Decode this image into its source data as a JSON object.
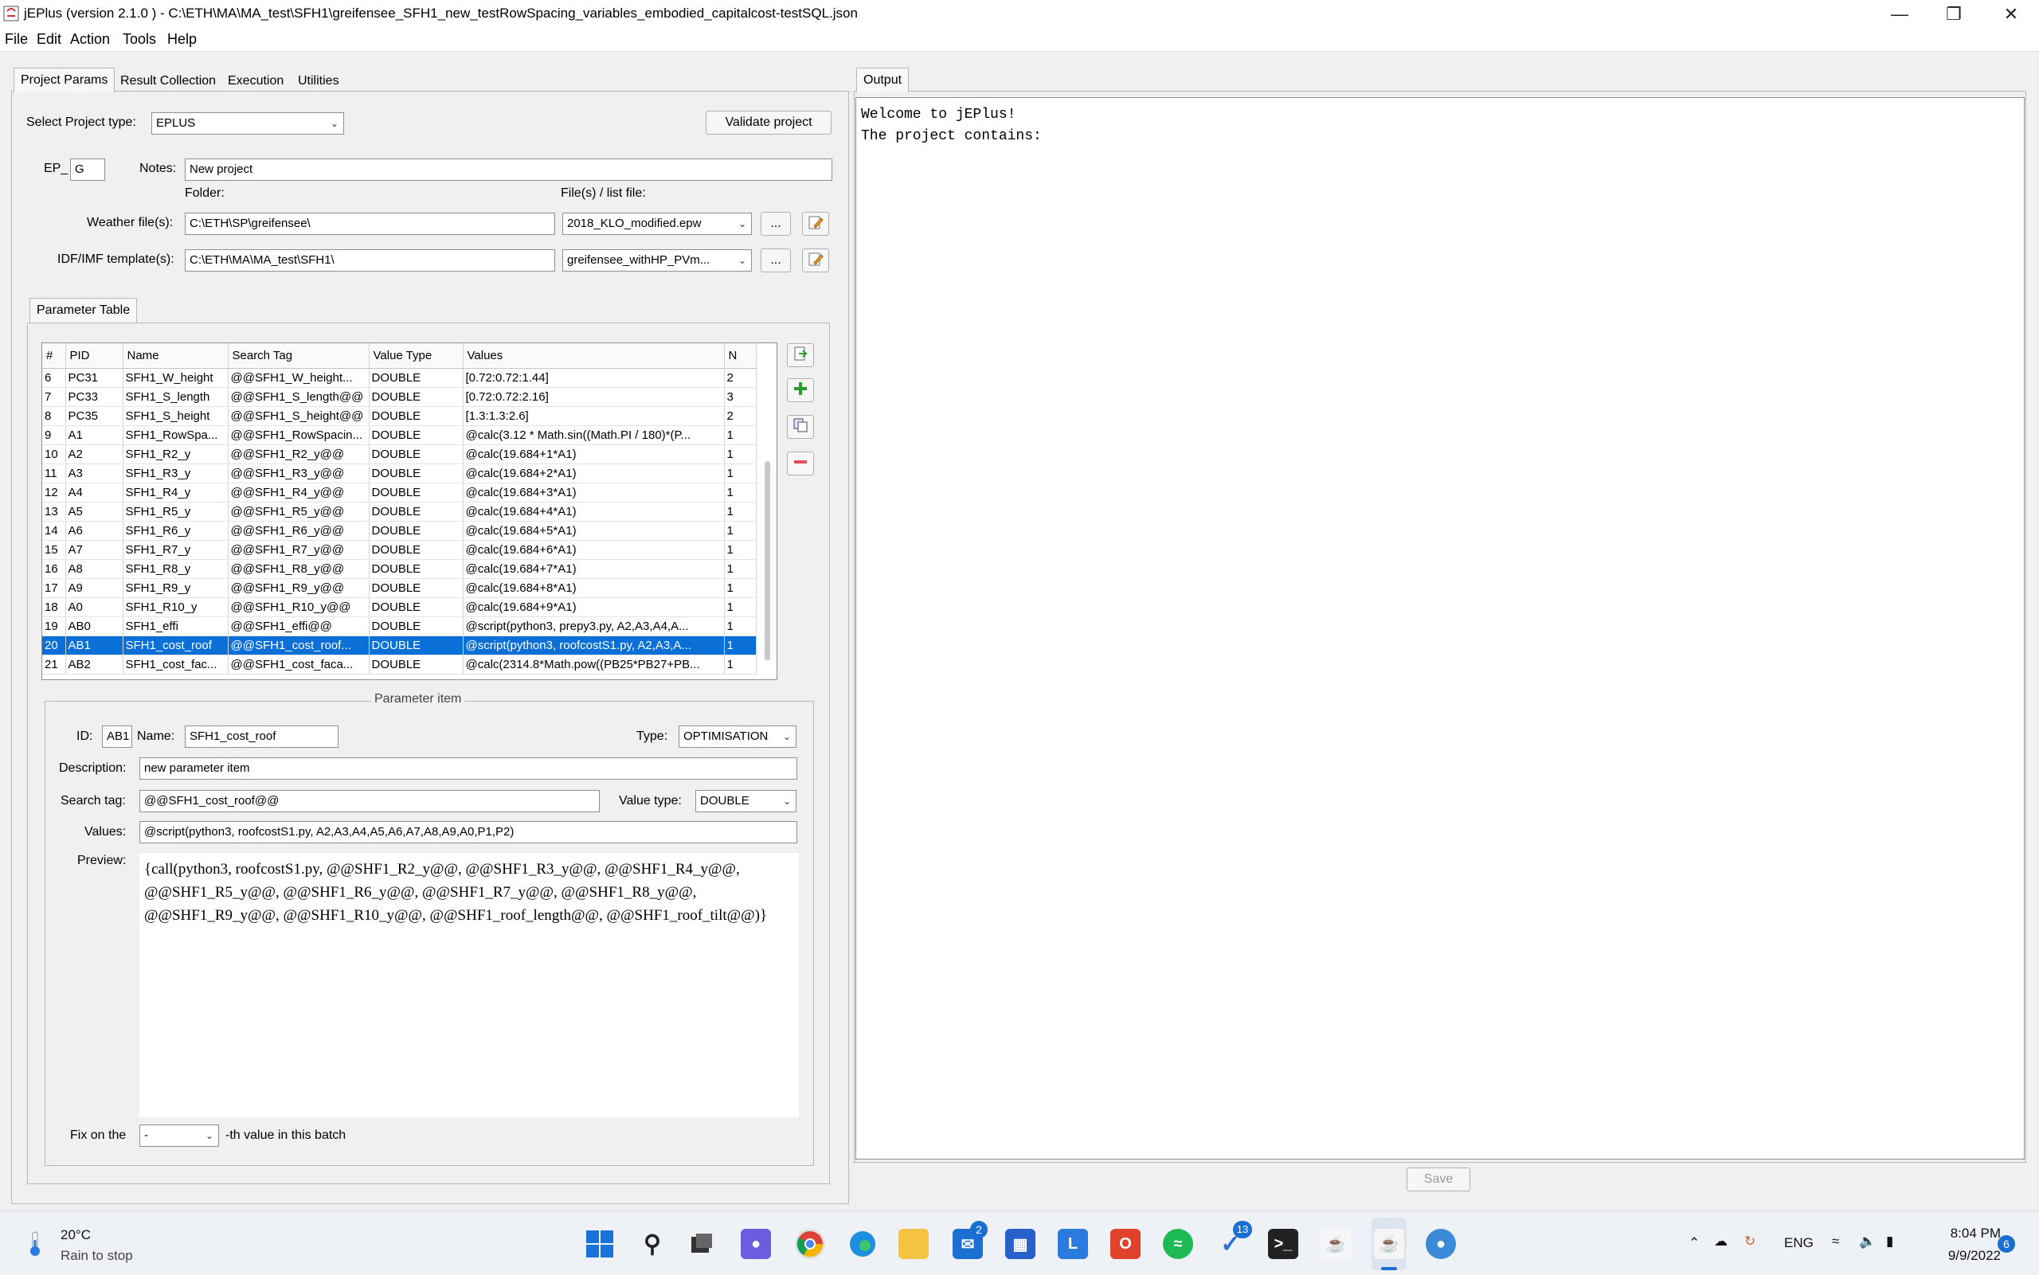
{
  "window": {
    "title": "jEPlus (version 2.1.0 )  - C:\\ETH\\MA\\MA_test\\SFH1\\greifensee_SFH1_new_testRowSpacing_variables_embodied_capitalcost-testSQL.json",
    "minimize_icon": "minimize-icon",
    "maximize_icon": "restore-icon",
    "close_icon": "close-icon"
  },
  "menu": [
    "File",
    "Edit",
    "Action",
    "Tools",
    "Help"
  ],
  "left_tabs": [
    "Project Params",
    "Result Collection",
    "Execution",
    "Utilities"
  ],
  "output_tab": "Output",
  "project": {
    "type_label": "Select Project type:",
    "type_value": "EPLUS",
    "validate_label": "Validate project",
    "ep_prefix": "EP_",
    "ep_value": "G",
    "notes_label": "Notes:",
    "notes_value": "New project",
    "folder_label": "Folder:",
    "files_label": "File(s) / list file:",
    "weather_label": "Weather file(s):",
    "weather_folder": "C:\\ETH\\SP\\greifensee\\",
    "weather_file": "2018_KLO_modified.epw",
    "idf_label": "IDF/IMF template(s):",
    "idf_folder": "C:\\ETH\\MA\\MA_test\\SFH1\\",
    "idf_file": "greifensee_withHP_PVm...",
    "browse_label": "..."
  },
  "param_table": {
    "tab_label": "Parameter Table",
    "columns": [
      "#",
      "PID",
      "Name",
      "Search Tag",
      "Value Type",
      "Values",
      "N"
    ],
    "rows": [
      [
        "6",
        "PC31",
        "SFH1_W_height",
        "@@SFH1_W_height...",
        "DOUBLE",
        "[0.72:0.72:1.44]",
        "2"
      ],
      [
        "7",
        "PC33",
        "SFH1_S_length",
        "@@SFH1_S_length@@",
        "DOUBLE",
        "[0.72:0.72:2.16]",
        "3"
      ],
      [
        "8",
        "PC35",
        "SFH1_S_height",
        "@@SFH1_S_height@@",
        "DOUBLE",
        "[1.3:1.3:2.6]",
        "2"
      ],
      [
        "9",
        "A1",
        "SFH1_RowSpa...",
        "@@SFH1_RowSpacin...",
        "DOUBLE",
        "@calc(3.12 * Math.sin((Math.PI / 180)*(P...",
        "1"
      ],
      [
        "10",
        "A2",
        "SFH1_R2_y",
        "@@SFH1_R2_y@@",
        "DOUBLE",
        "@calc(19.684+1*A1)",
        "1"
      ],
      [
        "11",
        "A3",
        "SFH1_R3_y",
        "@@SFH1_R3_y@@",
        "DOUBLE",
        "@calc(19.684+2*A1)",
        "1"
      ],
      [
        "12",
        "A4",
        "SFH1_R4_y",
        "@@SFH1_R4_y@@",
        "DOUBLE",
        "@calc(19.684+3*A1)",
        "1"
      ],
      [
        "13",
        "A5",
        "SFH1_R5_y",
        "@@SFH1_R5_y@@",
        "DOUBLE",
        "@calc(19.684+4*A1)",
        "1"
      ],
      [
        "14",
        "A6",
        "SFH1_R6_y",
        "@@SFH1_R6_y@@",
        "DOUBLE",
        "@calc(19.684+5*A1)",
        "1"
      ],
      [
        "15",
        "A7",
        "SFH1_R7_y",
        "@@SFH1_R7_y@@",
        "DOUBLE",
        "@calc(19.684+6*A1)",
        "1"
      ],
      [
        "16",
        "A8",
        "SFH1_R8_y",
        "@@SFH1_R8_y@@",
        "DOUBLE",
        "@calc(19.684+7*A1)",
        "1"
      ],
      [
        "17",
        "A9",
        "SFH1_R9_y",
        "@@SFH1_R9_y@@",
        "DOUBLE",
        "@calc(19.684+8*A1)",
        "1"
      ],
      [
        "18",
        "A0",
        "SFH1_R10_y",
        "@@SFH1_R10_y@@",
        "DOUBLE",
        "@calc(19.684+9*A1)",
        "1"
      ],
      [
        "19",
        "AB0",
        "SFH1_effi",
        "@@SFH1_effi@@",
        "DOUBLE",
        "@script(python3, prepy3.py, A2,A3,A4,A...",
        "1"
      ],
      [
        "20",
        "AB1",
        "SFH1_cost_roof",
        "@@SFH1_cost_roof...",
        "DOUBLE",
        "@script(python3, roofcostS1.py, A2,A3,A...",
        "1"
      ],
      [
        "21",
        "AB2",
        "SFH1_cost_fac...",
        "@@SFH1_cost_faca...",
        "DOUBLE",
        "@calc(2314.8*Math.pow((PB25*PB27+PB...",
        "1"
      ]
    ],
    "selected_row": 14
  },
  "param_item": {
    "legend": "Parameter item",
    "id_label": "ID:",
    "id_value": "AB1",
    "name_label": "Name:",
    "name_value": "SFH1_cost_roof",
    "type_label": "Type:",
    "type_value": "OPTIMISATION",
    "desc_label": "Description:",
    "desc_value": "new parameter item",
    "tag_label": "Search tag:",
    "tag_value": "@@SFH1_cost_roof@@",
    "vtype_label": "Value type:",
    "vtype_value": "DOUBLE",
    "values_label": "Values:",
    "values_value": "@script(python3, roofcostS1.py, A2,A3,A4,A5,A6,A7,A8,A9,A0,P1,P2)",
    "preview_label": "Preview:",
    "preview_text": "{call(python3, roofcostS1.py, @@SHF1_R2_y@@, @@SHF1_R3_y@@, @@SHF1_R4_y@@, @@SHF1_R5_y@@, @@SHF1_R6_y@@, @@SHF1_R7_y@@, @@SHF1_R8_y@@, @@SHF1_R9_y@@, @@SHF1_R10_y@@, @@SHF1_roof_length@@, @@SHF1_roof_tilt@@)}",
    "fix_label": "Fix on the",
    "fix_value": "-",
    "fix_suffix": "-th value in this batch"
  },
  "output": {
    "text": "Welcome to jEPlus!\nThe project contains:",
    "save_label": "Save"
  },
  "taskbar": {
    "weather_temp": "20°C",
    "weather_desc": "Rain to stop",
    "lang": "ENG",
    "time": "8:04 PM",
    "date": "9/9/2022",
    "notif_count": "6",
    "mail_badge": "2",
    "todo_badge": "13"
  }
}
